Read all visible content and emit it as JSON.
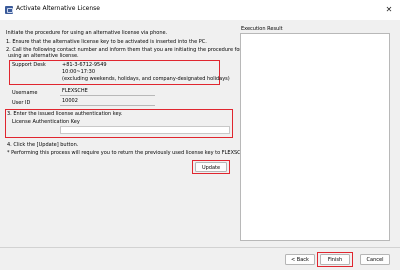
{
  "window": {
    "title": "Activate Alternative License",
    "close_glyph": "✕"
  },
  "instructions": {
    "intro": "Initiate the procedure for using an alternative license via phone.",
    "step1": "1. Ensure that the alternative license key to be activated is inserted into the PC.",
    "step2_line1": "2. Call the following contact number and inform them that you are initiating the procedure for",
    "step2_line2": "using an alternative license.",
    "step3": "3. Enter the issued license authentication key.",
    "step4": "4. Click the [Update] button.",
    "note": "* Performing this process will require you to return the previously used license key to FLEXSCHE."
  },
  "support": {
    "label": "Support Desk",
    "phone": "+81-3-6712-9549",
    "hours": "10:00~17:30",
    "hours_note": "(excluding weekends, holidays, and company-designated holidays)"
  },
  "user": {
    "username_label": "Username",
    "username_value": "FLEXSCHE",
    "userid_label": "User ID",
    "userid_value": "10002"
  },
  "license_key": {
    "label": "License Authentication Key",
    "value": ""
  },
  "buttons": {
    "update": "Update",
    "back": "< Back",
    "finish": "Finish",
    "cancel": "Cancel"
  },
  "result": {
    "label": "Execution Result"
  },
  "colors": {
    "highlight": "#e0262f"
  }
}
